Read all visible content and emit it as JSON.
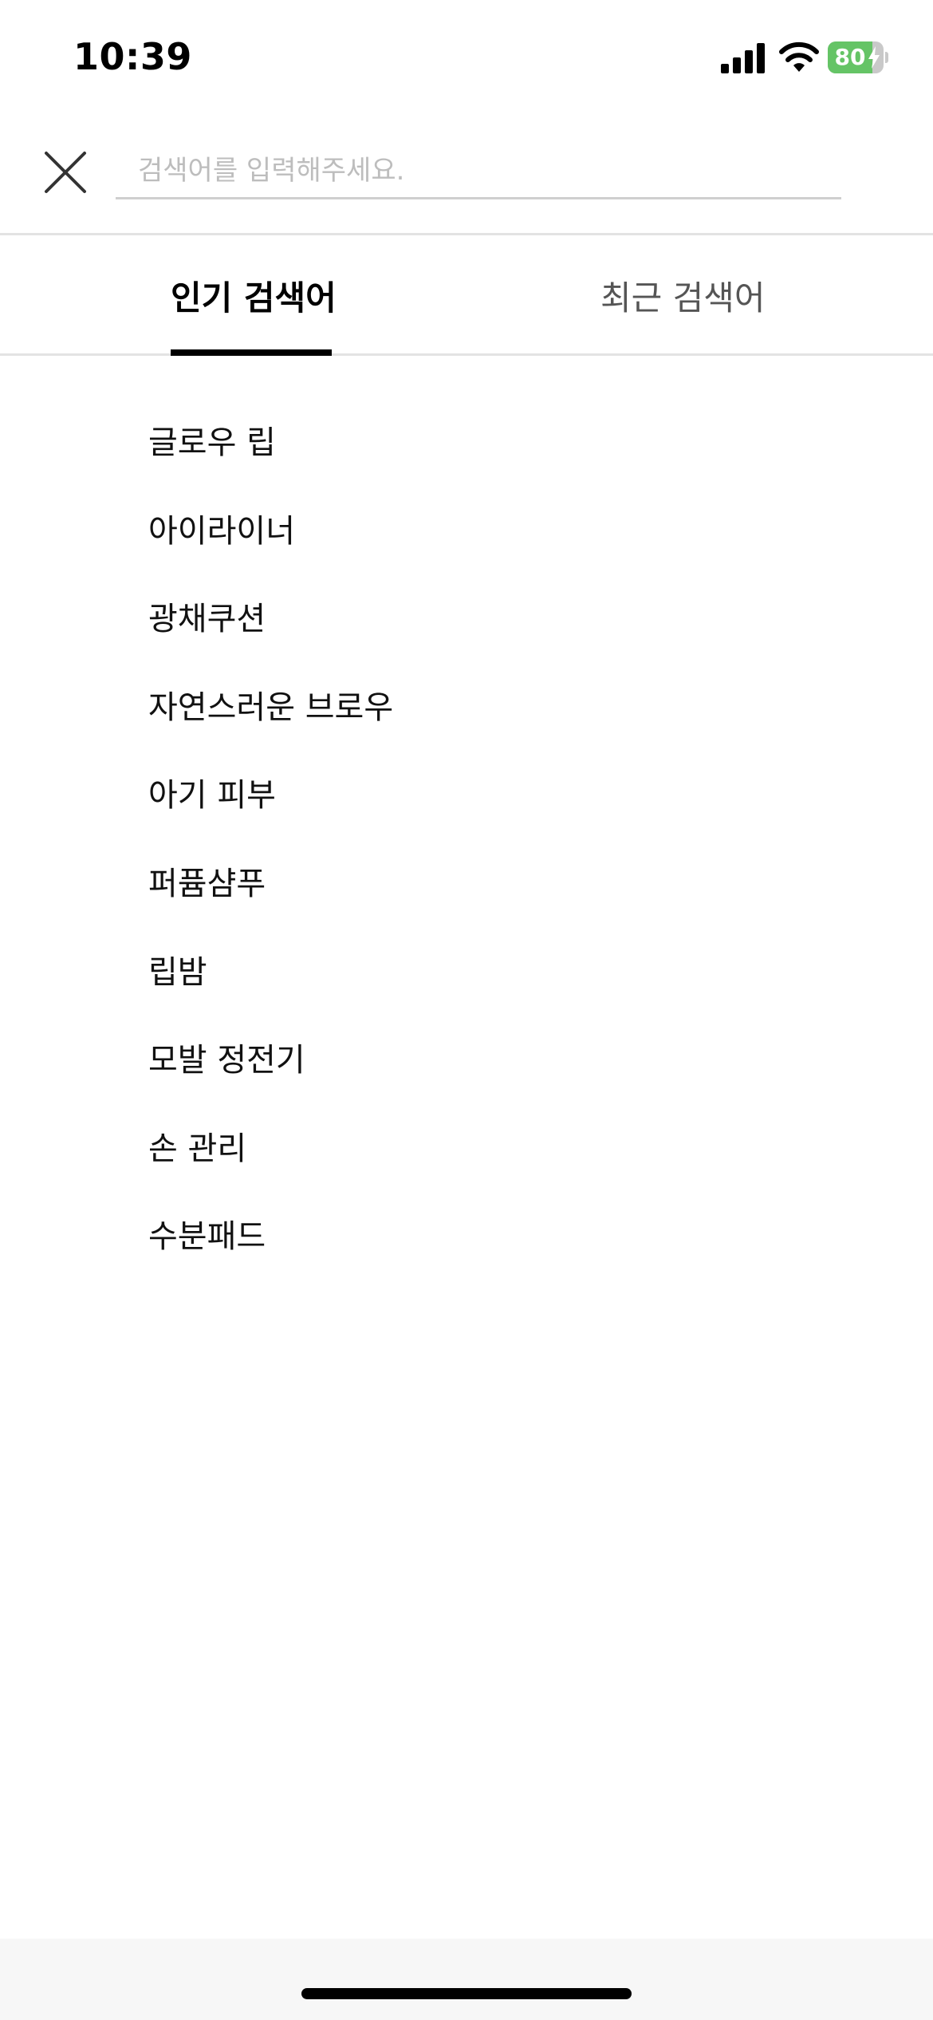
{
  "status_bar": {
    "time": "10:39",
    "battery_level": "80",
    "battery_percent": 80,
    "battery_color": "#65c466",
    "icons": [
      "signal-icon",
      "wifi-icon",
      "battery-icon",
      "charging-bolt-icon"
    ]
  },
  "search": {
    "placeholder": "검색어를 입력해주세요.",
    "value": "",
    "close_icon": "close-icon"
  },
  "tabs": [
    {
      "label": "인기 검색어",
      "active": true
    },
    {
      "label": "최근 검색어",
      "active": false
    }
  ],
  "popular_keywords": [
    "글로우 립",
    "아이라이너",
    "광채쿠션",
    "자연스러운 브로우",
    "아기 피부",
    "퍼퓸샴푸",
    "립밤",
    "모발 정전기",
    "손 관리",
    "수분패드"
  ],
  "colors": {
    "active_tab": "#000000",
    "inactive_tab": "#555555",
    "divider": "#e3e3e3",
    "placeholder": "#bdbdbd"
  }
}
